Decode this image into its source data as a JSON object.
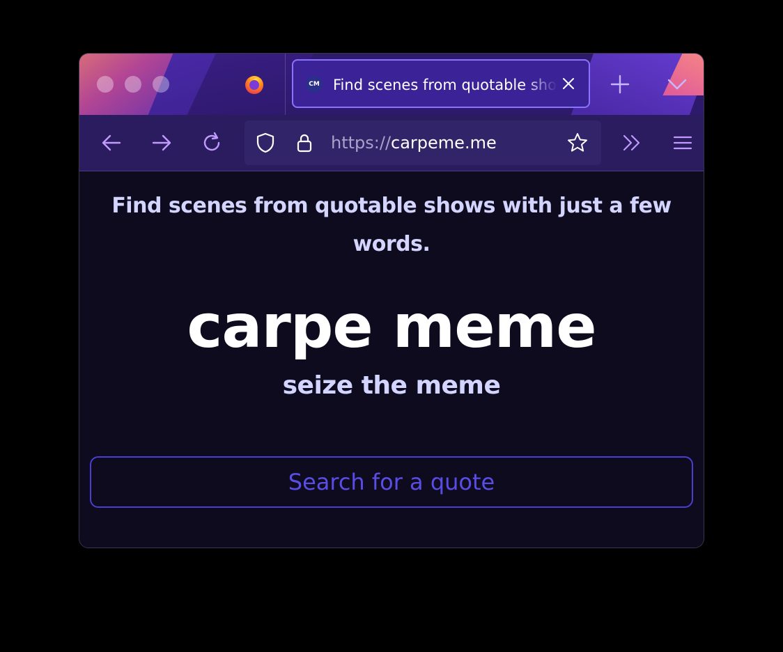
{
  "browser": {
    "tab": {
      "favicon_text": "CM",
      "title": "Find scenes from quotable shows with just a few words."
    },
    "url": {
      "scheme": "https://",
      "host": "carpeme.me"
    }
  },
  "page": {
    "tagline": "Find scenes from quotable shows with just a few words.",
    "brand": "carpe meme",
    "subtitle": "seize the meme",
    "search": {
      "placeholder": "Search for a quote",
      "value": ""
    }
  },
  "colors": {
    "background": "#0e0b1f",
    "tab_strip": "#2d1a6b",
    "accent": "#8c73ff",
    "text_light": "#d3d5ff",
    "search_accent": "#5a4de6"
  },
  "icons": {
    "traffic_lights": [
      "close-icon",
      "minimize-icon",
      "zoom-icon"
    ],
    "browser_logo": "firefox-logo-icon",
    "tab_close": "close-icon",
    "new_tab": "plus-icon",
    "tab_list": "chevron-down-icon",
    "back": "arrow-left-icon",
    "forward": "arrow-right-icon",
    "reload": "reload-icon",
    "tracking_protection": "shield-icon",
    "security": "lock-icon",
    "bookmark": "star-icon",
    "overflow": "double-chevron-right-icon",
    "menu": "hamburger-menu-icon"
  }
}
